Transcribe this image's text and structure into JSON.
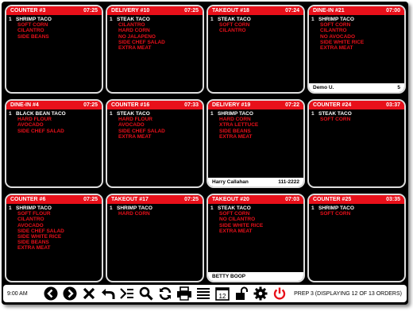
{
  "tickets": [
    {
      "title": "COUNTER #3",
      "time": "07:25",
      "items": [
        {
          "qty": "1",
          "name": "SHRIMP TACO",
          "mods": [
            "SOFT CORN",
            "CILANTRO",
            "SIDE BEANS"
          ]
        }
      ],
      "footer": null
    },
    {
      "title": "DELIVERY #10",
      "time": "07:25",
      "items": [
        {
          "qty": "1",
          "name": "STEAK TACO",
          "mods": [
            "CILANTRO",
            "HARD CORN",
            "NO JALAPENO",
            "SIDE CHEF SALAD",
            "EXTRA MEAT"
          ]
        }
      ],
      "footer": null
    },
    {
      "title": "TAKEOUT #18",
      "time": "07:24",
      "items": [
        {
          "qty": "1",
          "name": "STEAK TACO",
          "mods": [
            "SOFT CORN",
            "CILANTRO"
          ]
        }
      ],
      "footer": null
    },
    {
      "title": "DINE-IN #21",
      "time": "07:00",
      "items": [
        {
          "qty": "1",
          "name": "SHRIMP TACO",
          "mods": [
            "SOFT CORN",
            "CILANTRO",
            "NO AVOCADO",
            "SIDE WHITE RICE",
            "EXTRA MEAT"
          ]
        }
      ],
      "footer": {
        "left": "Demo U.",
        "right": "5"
      }
    },
    {
      "title": "DINE-IN #4",
      "time": "07:25",
      "items": [
        {
          "qty": "1",
          "name": "BLACK BEAN TACO",
          "mods": [
            "HARD FLOUR",
            "AVOCADO",
            "SIDE CHEF SALAD"
          ]
        }
      ],
      "footer": null
    },
    {
      "title": "COUNTER #16",
      "time": "07:33",
      "items": [
        {
          "qty": "1",
          "name": "STEAK TACO",
          "mods": [
            "HARD FLOUR",
            "AVOCADO",
            "SIDE CHEF SALAD",
            "EXTRA MEAT"
          ]
        }
      ],
      "footer": null
    },
    {
      "title": "DELIVERY #19",
      "time": "07:22",
      "items": [
        {
          "qty": "1",
          "name": "SHRIMP TACO",
          "mods": [
            "HARD CORN",
            "XTRA LETTUCE",
            "SIDE BEANS",
            "EXTRA MEAT"
          ]
        }
      ],
      "footer": {
        "left": "Harry  Callahan",
        "right": "111-2222"
      }
    },
    {
      "title": "COUNTER #24",
      "time": "03:37",
      "items": [
        {
          "qty": "1",
          "name": "STEAK TACO",
          "mods": [
            "SOFT CORN"
          ]
        }
      ],
      "footer": null
    },
    {
      "title": "COUNTER #6",
      "time": "07:25",
      "items": [
        {
          "qty": "1",
          "name": "SHRIMP TACO",
          "mods": [
            "SOFT FLOUR",
            "CILANTRO",
            "AVOCADO",
            "SIDE CHEF SALAD",
            "SIDE WHITE RICE",
            "SIDE BEANS",
            "EXTRA MEAT"
          ]
        }
      ],
      "footer": null
    },
    {
      "title": "TAKEOUT #17",
      "time": "07:25",
      "items": [
        {
          "qty": "1",
          "name": "SHRIMP TACO",
          "mods": [
            "HARD CORN"
          ]
        }
      ],
      "footer": null
    },
    {
      "title": "TAKEOUT #20",
      "time": "07:03",
      "items": [
        {
          "qty": "1",
          "name": "STEAK TACO",
          "mods": [
            "SOFT CORN",
            "NO CILANTRO",
            "SIDE WHITE RICE",
            "EXTRA MEAT"
          ]
        }
      ],
      "footer": {
        "left": "BETTY BOOP",
        "right": ""
      }
    },
    {
      "title": "COUNTER #25",
      "time": "03:35",
      "items": [
        {
          "qty": "1",
          "name": "SHRIMP TACO",
          "mods": [
            "SOFT CORN"
          ]
        }
      ],
      "footer": null
    }
  ],
  "toolbar": {
    "clock": "9:00 AM",
    "status": "PREP 3 (DISPLAYING 12 OF 13 ORDERS)",
    "calendar_day": "12",
    "buttons": [
      "prev-icon",
      "next-icon",
      "close-icon",
      "undo-icon",
      "summary-icon",
      "search-icon",
      "refresh-icon",
      "print-icon",
      "menu-icon",
      "calendar-icon",
      "unlock-icon",
      "gear-icon",
      "power-icon"
    ]
  },
  "colors": {
    "accent": "#e8101a",
    "background": "#000000",
    "panel": "#ffffff"
  }
}
